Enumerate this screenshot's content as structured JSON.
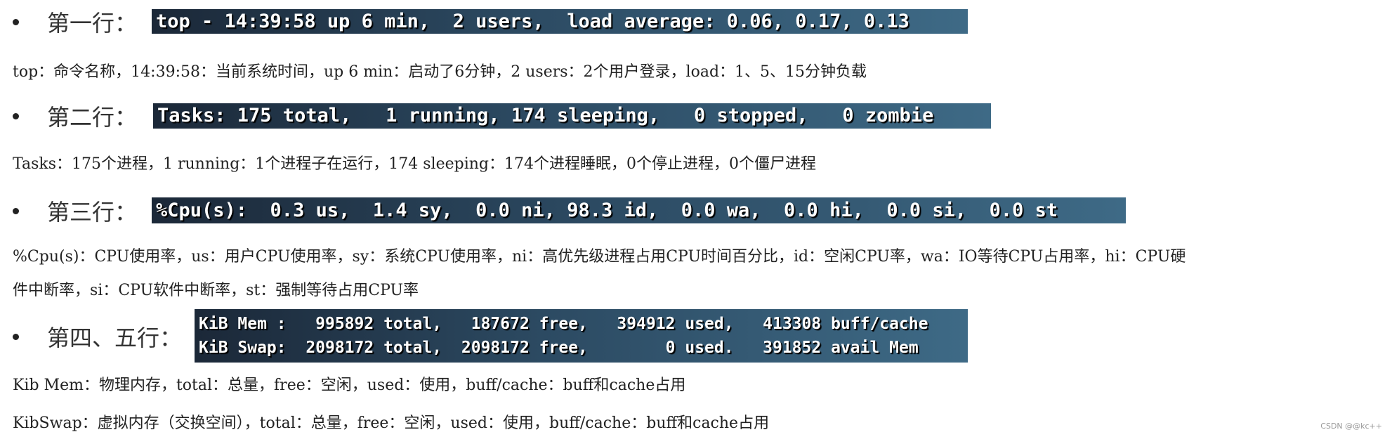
{
  "sections": [
    {
      "heading": "第一行：",
      "terminal": [
        "top - 14:39:58 up 6 min,  2 users,  load average: 0.06, 0.17, 0.13"
      ],
      "desc": [
        "top：命令名称，14:39:58：当前系统时间，up 6 min：启动了6分钟，2 users：2个用户登录，load：1、5、15分钟负载"
      ]
    },
    {
      "heading": "第二行：",
      "terminal": [
        "Tasks: 175 total,   1 running, 174 sleeping,   0 stopped,   0 zombie"
      ],
      "desc": [
        "Tasks：175个进程，1 running：1个进程子在运行，174 sleeping：174个进程睡眠，0个停止进程，0个僵尸进程"
      ]
    },
    {
      "heading": "第三行：",
      "terminal": [
        "%Cpu(s):  0.3 us,  1.4 sy,  0.0 ni, 98.3 id,  0.0 wa,  0.0 hi,  0.0 si,  0.0 st"
      ],
      "desc": [
        "%Cpu(s)：CPU使用率，us：用户CPU使用率，sy：系统CPU使用率，ni：高优先级进程占用CPU时间百分比，id：空闲CPU率，wa：IO等待CPU占用率，hi：CPU硬",
        "件中断率，si：CPU软件中断率，st：强制等待占用CPU率"
      ]
    },
    {
      "heading": "第四、五行：",
      "terminal": [
        "KiB Mem :   995892 total,   187672 free,   394912 used,   413308 buff/cache",
        "KiB Swap:  2098172 total,  2098172 free,        0 used.   391852 avail Mem"
      ],
      "desc": [
        "Kib Mem：物理内存，total：总量，free：空闲，used：使用，buff/cache：buff和cache占用",
        "KibSwap：虚拟内存（交换空间），total：总量，free：空闲，used：使用，buff/cache：buff和cache占用"
      ]
    }
  ],
  "watermark": "CSDN @@kc++"
}
